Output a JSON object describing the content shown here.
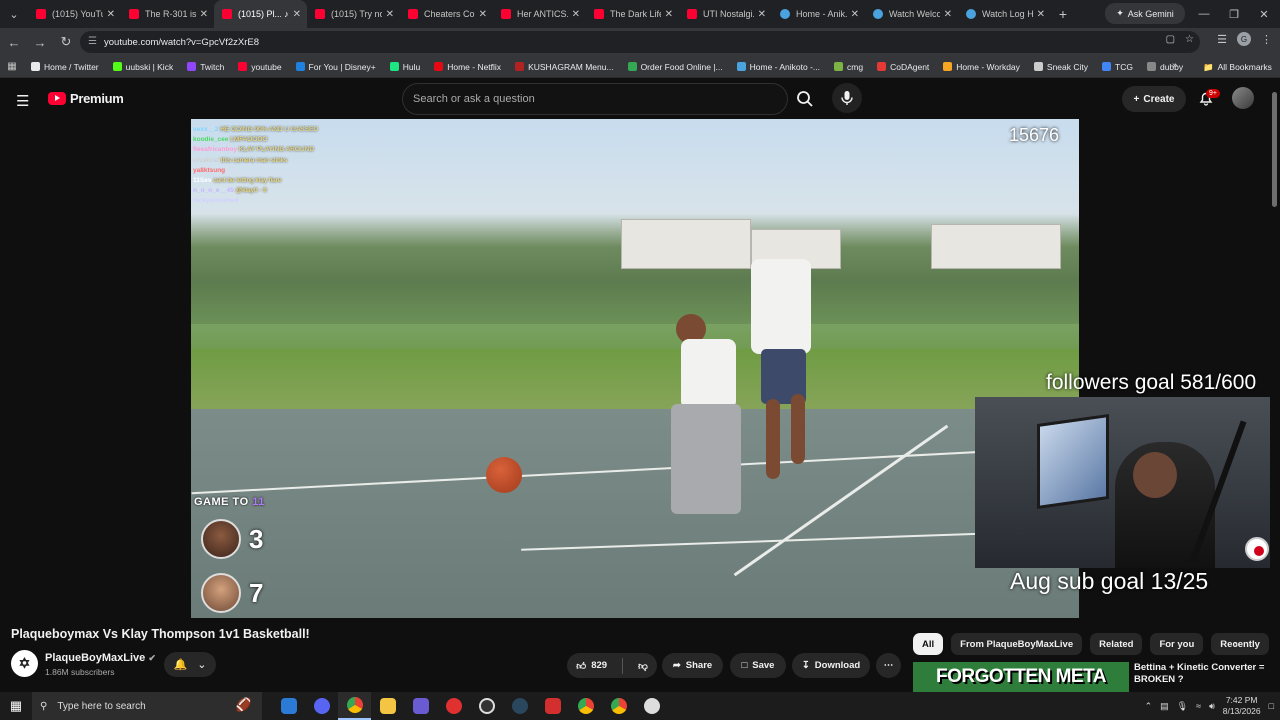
{
  "browser": {
    "tabs": [
      {
        "label": "(1015) YouTube",
        "favicon": "youtube-icon"
      },
      {
        "label": "The R-301 is...",
        "favicon": "youtube-icon"
      },
      {
        "label": "(1015) Pl...",
        "favicon": "youtube-icon",
        "active": true
      },
      {
        "label": "(1015) Try no...",
        "favicon": "youtube-icon"
      },
      {
        "label": "Cheaters Co...",
        "favicon": "youtube-icon"
      },
      {
        "label": "Her ANTICS...",
        "favicon": "youtube-icon"
      },
      {
        "label": "The Dark Life...",
        "favicon": "youtube-icon"
      },
      {
        "label": "UTI Nostalgi...",
        "favicon": "youtube-icon"
      },
      {
        "label": "Home - Anik...",
        "favicon": "globe-icon"
      },
      {
        "label": "Watch Welco...",
        "favicon": "globe-icon"
      },
      {
        "label": "Watch Log H...",
        "favicon": "globe-icon"
      }
    ],
    "ask_gemini": "Ask Gemini",
    "url": "youtube.com/watch?v=GpcVf2zXrE8",
    "bookmarks": [
      {
        "label": "Home / Twitter",
        "color": "#e7e9ea"
      },
      {
        "label": "uubski | Kick",
        "color": "#53fc18"
      },
      {
        "label": "Twitch",
        "color": "#9146ff"
      },
      {
        "label": "youtube",
        "color": "#ff0033"
      },
      {
        "label": "For You | Disney+",
        "color": "#1f80e0"
      },
      {
        "label": "Hulu",
        "color": "#1ce783"
      },
      {
        "label": "Home - Netflix",
        "color": "#e50914"
      },
      {
        "label": "KUSHAGRAM Menu...",
        "color": "#b22222"
      },
      {
        "label": "Order Food Online |...",
        "color": "#34a853"
      },
      {
        "label": "Home - Anikoto -...",
        "color": "#4aa3df"
      },
      {
        "label": "cmg",
        "color": "#7cb342"
      },
      {
        "label": "CoDAgent",
        "color": "#e53935"
      },
      {
        "label": "Home - Workday",
        "color": "#f5a623"
      },
      {
        "label": "Sneak City",
        "color": "#cccccc"
      },
      {
        "label": "TCG",
        "color": "#4285f4"
      },
      {
        "label": "dubby",
        "color": "#888888"
      }
    ],
    "all_bookmarks": "All Bookmarks"
  },
  "youtube": {
    "logo_text": "Premium",
    "search_placeholder": "Search or ask a question",
    "create_label": "Create",
    "notification_count": "9+"
  },
  "stream_overlay": {
    "viewer_count": "15676",
    "chat": [
      {
        "user": "vexx__2",
        "user_color": "#7ed6ff",
        "msg": "HE GOING 90% AND U GASSED"
      },
      {
        "user": "koodie_cee",
        "user_color": "#4cd964",
        "msg": "LMFAOOOO"
      },
      {
        "user": "fleeafricanboy",
        "user_color": "#ff9bd2",
        "msg": "KLAY PLAYING AROUND"
      },
      {
        "user": "crushraf",
        "user_color": "#cfcfcf",
        "msg": "this camera man stinks"
      },
      {
        "user": "ya8ktsung",
        "user_color": "#ff6b6b",
        "msg": ""
      },
      {
        "user": "11Sev",
        "user_color": "#ffffff",
        "msg": "cant be letting klay flare"
      },
      {
        "user": "n_o_n_e__45",
        "user_color": "#c9b6ff",
        "msg": "@klay0 - fr"
      },
      {
        "user": "nickyunnamed",
        "user_color": "#d0d0ff",
        "msg": ""
      }
    ],
    "game_to_label": "GAME TO",
    "game_to_value": "11",
    "scores": [
      {
        "name": "player-one",
        "score": "3"
      },
      {
        "name": "player-two",
        "score": "7"
      }
    ],
    "followers_goal": "followers goal 581/600",
    "sub_goal": "Aug sub goal 13/25"
  },
  "video": {
    "title": "Plaqueboymax Vs Klay Thompson 1v1 Basketball!",
    "channel": "PlaqueBoyMaxLive",
    "subscribers": "1.86M subscribers",
    "likes": "829",
    "share_label": "Share",
    "save_label": "Save",
    "download_label": "Download"
  },
  "sidebar": {
    "chips": [
      "All",
      "From PlaqueBoyMaxLive",
      "Related",
      "For you",
      "Recently"
    ],
    "rec_thumb_text": "FORGOTTEN META",
    "rec_title": "Bettina + Kinetic Converter = BROKEN ?"
  },
  "taskbar": {
    "search_placeholder": "Type here to search",
    "time": "7:42 PM",
    "date": "8/13/2026"
  }
}
